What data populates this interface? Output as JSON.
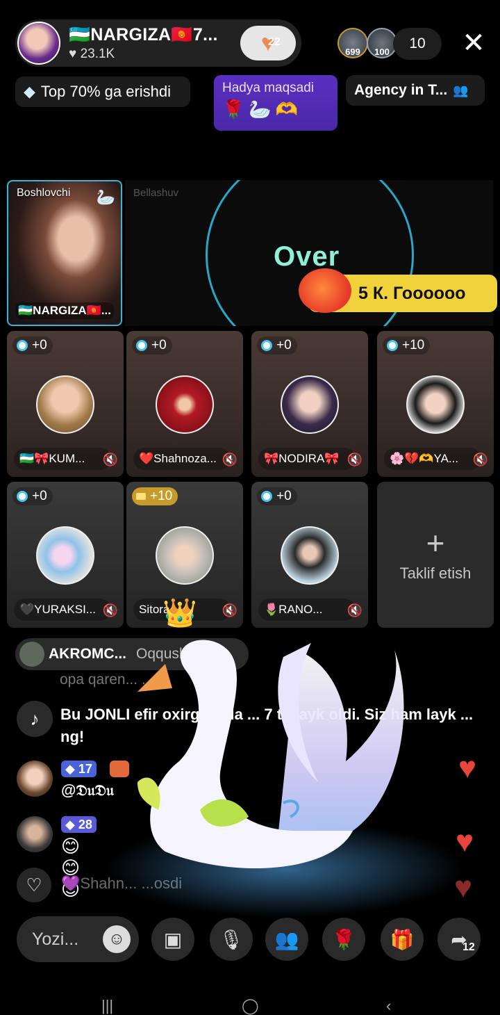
{
  "header": {
    "host_name": "🇺🇿NARGIZA🇰🇬7...",
    "host_likes": "23.1K",
    "follow_count": "22",
    "viewer_badges": [
      "699",
      "100"
    ],
    "viewer_count": "10"
  },
  "badges": {
    "top_rank": "Top 70% ga erishdi",
    "gift_goal_title": "Hadya maqsadi",
    "gift_goal_icons": "🌹🦢🫶",
    "agency": "Agency in T..."
  },
  "stage": {
    "host_label": "Boshlovchi",
    "host_name": "🇺🇿NARGIZA🇰🇬...",
    "battle_label": "Bellashuv",
    "battle_status": "Over",
    "comment": "5 К. Гоооооо"
  },
  "guests": [
    {
      "score": "+0",
      "name": "🇺🇿🎀KUM..."
    },
    {
      "score": "+0",
      "name": "❤️Shahnoza..."
    },
    {
      "score": "+0",
      "name": "🎀NODIRA🎀"
    },
    {
      "score": "+10",
      "name": "🌸💔🫶YA..."
    },
    {
      "score": "+0",
      "name": "🖤YURAKSI..."
    },
    {
      "score": "+10",
      "name": "Sitora"
    },
    {
      "score": "+0",
      "name": "🌷RANO..."
    }
  ],
  "invite_label": "Taklif etish",
  "chat": {
    "gift_user": "AKROMC...",
    "gift_action": "Oqqush yub...",
    "faded_line": "opa qaren... ...dl",
    "system_message": "Bu JONLI efir oxirgi ... da ... 7 ta layk oldi. Siz ham layk ... ng!",
    "users": [
      {
        "level": "17",
        "text": "@𝔇𝔲𝔇𝔲"
      },
      {
        "level": "28",
        "text": "😊😊😊"
      }
    ],
    "faded_bottom": "💜Shahn...  ...osdi"
  },
  "bottom_bar": {
    "input_placeholder": "Yozi...",
    "share_count": "12"
  },
  "colors": {
    "accent_cyan": "#39b6d6",
    "goal_purple": "#5a2fc0",
    "comment_yellow": "#f2d23a",
    "heart_red": "#e8443a"
  }
}
